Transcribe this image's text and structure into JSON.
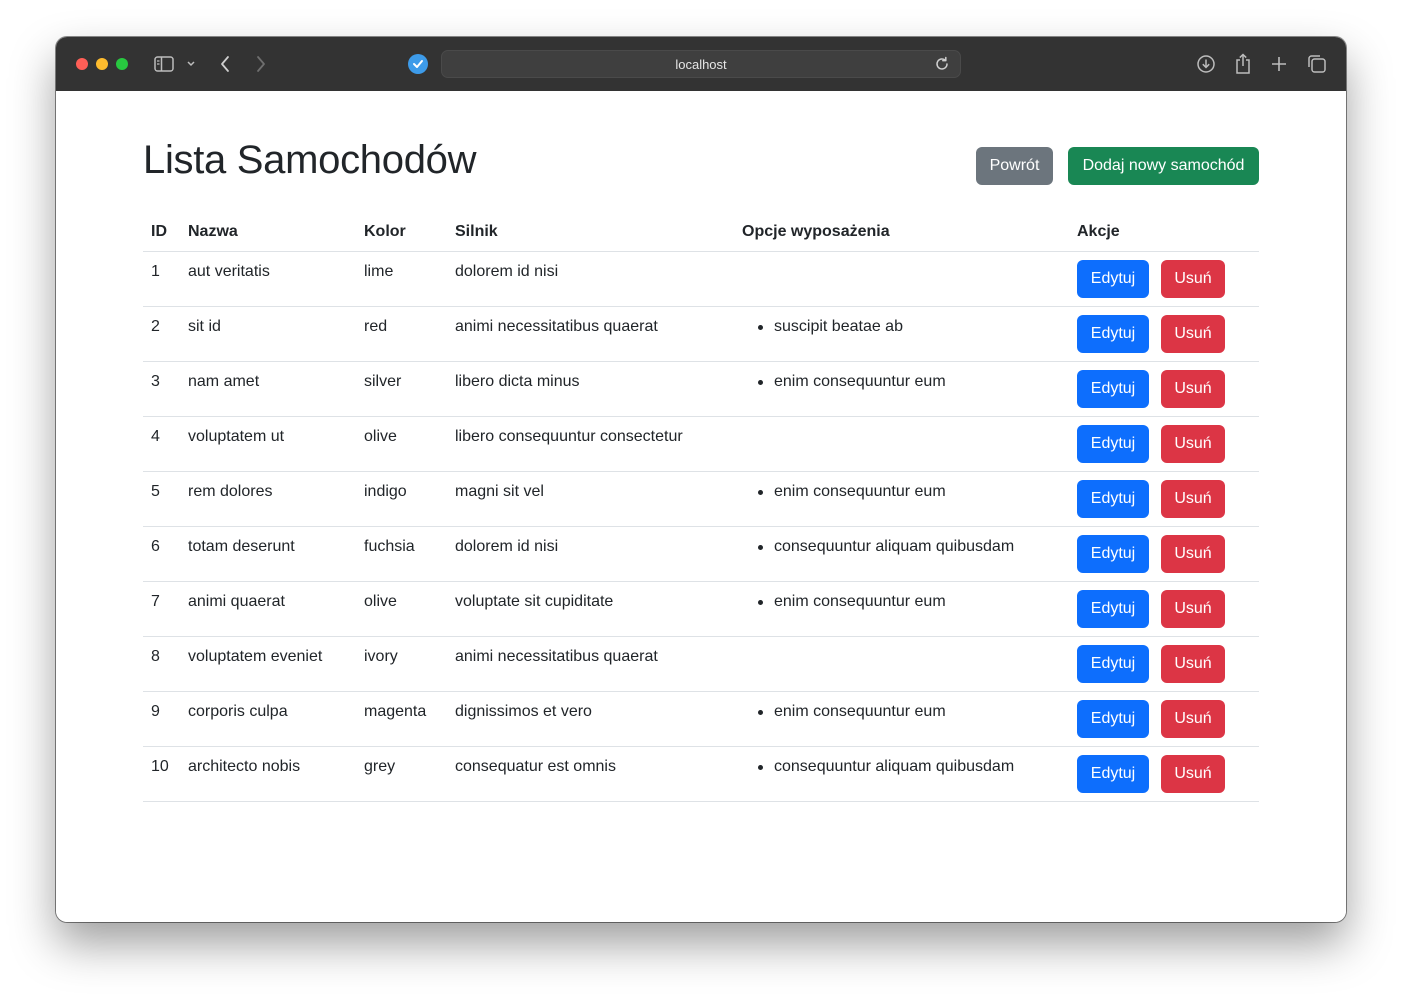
{
  "browser": {
    "url": "localhost"
  },
  "header": {
    "title": "Lista Samochodów",
    "back_label": "Powrót",
    "add_label": "Dodaj nowy samochód"
  },
  "table": {
    "columns": [
      "ID",
      "Nazwa",
      "Kolor",
      "Silnik",
      "Opcje wyposażenia",
      "Akcje"
    ],
    "edit_label": "Edytuj",
    "delete_label": "Usuń",
    "rows": [
      {
        "id": "1",
        "name": "aut veritatis",
        "color": "lime",
        "engine": "dolorem id nisi",
        "options": []
      },
      {
        "id": "2",
        "name": "sit id",
        "color": "red",
        "engine": "animi necessitatibus quaerat",
        "options": [
          "suscipit beatae ab"
        ]
      },
      {
        "id": "3",
        "name": "nam amet",
        "color": "silver",
        "engine": "libero dicta minus",
        "options": [
          "enim consequuntur eum"
        ]
      },
      {
        "id": "4",
        "name": "voluptatem ut",
        "color": "olive",
        "engine": "libero consequuntur consectetur",
        "options": []
      },
      {
        "id": "5",
        "name": "rem dolores",
        "color": "indigo",
        "engine": "magni sit vel",
        "options": [
          "enim consequuntur eum"
        ]
      },
      {
        "id": "6",
        "name": "totam deserunt",
        "color": "fuchsia",
        "engine": "dolorem id nisi",
        "options": [
          "consequuntur aliquam quibusdam"
        ]
      },
      {
        "id": "7",
        "name": "animi quaerat",
        "color": "olive",
        "engine": "voluptate sit cupiditate",
        "options": [
          "enim consequuntur eum"
        ]
      },
      {
        "id": "8",
        "name": "voluptatem eveniet",
        "color": "ivory",
        "engine": "animi necessitatibus quaerat",
        "options": []
      },
      {
        "id": "9",
        "name": "corporis culpa",
        "color": "magenta",
        "engine": "dignissimos et vero",
        "options": [
          "enim consequuntur eum"
        ]
      },
      {
        "id": "10",
        "name": "architecto nobis",
        "color": "grey",
        "engine": "consequatur est omnis",
        "options": [
          "consequuntur aliquam quibusdam"
        ]
      }
    ]
  },
  "colors": {
    "primary": "#0d6efd",
    "danger": "#dc3545",
    "success": "#198754",
    "secondary": "#6c757d",
    "titlebar": "#333333"
  },
  "icons": [
    "sidebar-icon",
    "chevron-down-icon",
    "back-arrow-icon",
    "forward-arrow-icon",
    "shield-check-icon",
    "reload-icon",
    "download-icon",
    "share-icon",
    "new-tab-icon",
    "tabs-overview-icon"
  ]
}
